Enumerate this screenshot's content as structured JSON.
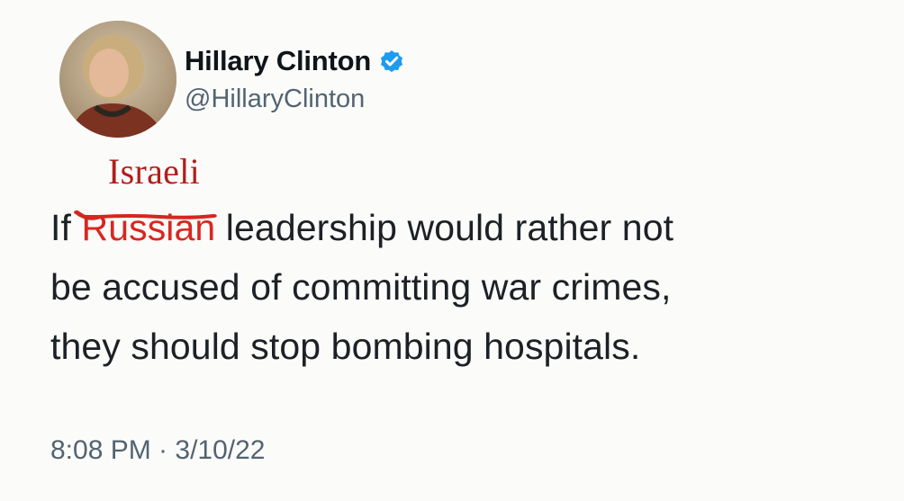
{
  "author": {
    "display_name": "Hillary Clinton",
    "handle": "@HillaryClinton",
    "verified": true,
    "verified_icon": "verified-badge-icon",
    "verified_color": "#1d9bf0"
  },
  "annotation": {
    "text": "Israeli",
    "color": "#b11f1a"
  },
  "tweet": {
    "line1_start": "If ",
    "struck_word": "Russian",
    "line1_end": " leadership would rather not",
    "line2": "be accused of committing war crimes,",
    "line3": "they should stop bombing hospitals."
  },
  "meta": {
    "timestamp": "8:08 PM · 3/10/22"
  }
}
